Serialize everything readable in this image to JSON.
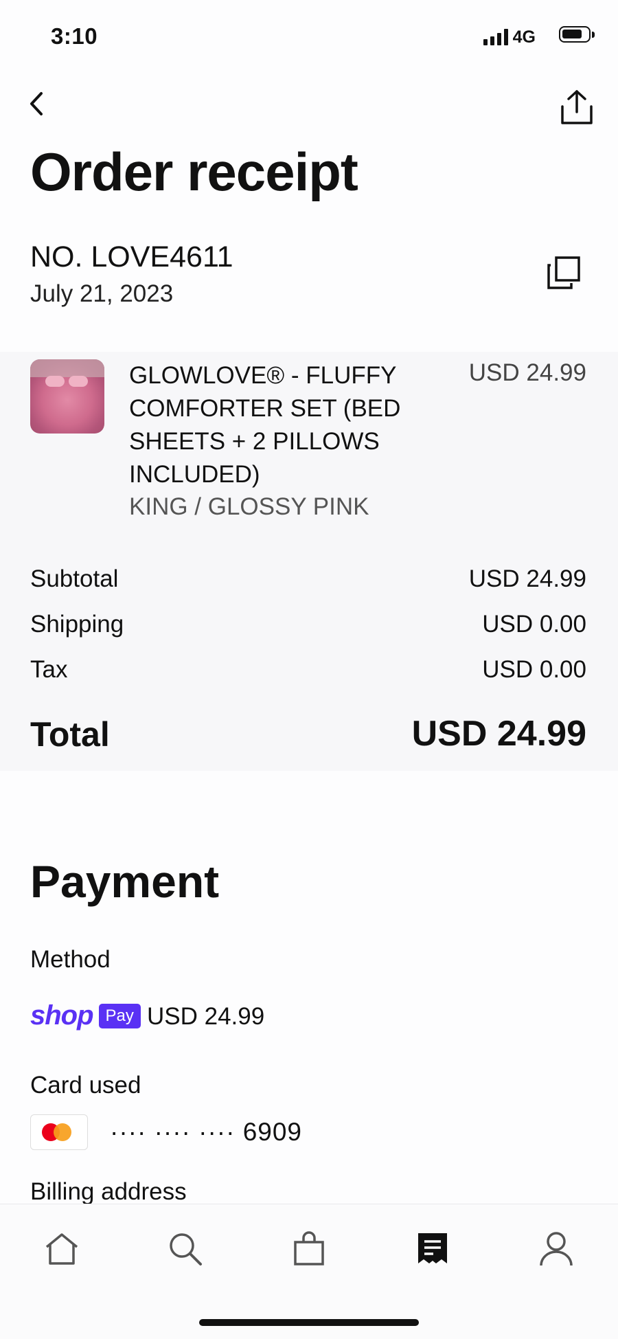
{
  "status_bar": {
    "time": "3:10",
    "network": "4G"
  },
  "header": {
    "title": "Order receipt"
  },
  "order": {
    "number": "NO. LOVE4611",
    "date": "July 21, 2023"
  },
  "item": {
    "name": "GLOWLOVE® - FLUFFY COMFORTER SET (BED SHEETS + 2 PILLOWS INCLUDED)",
    "variant": "KING / GLOSSY PINK",
    "price": "USD 24.99"
  },
  "summary": {
    "subtotal_label": "Subtotal",
    "subtotal_value": "USD 24.99",
    "shipping_label": "Shipping",
    "shipping_value": "USD 0.00",
    "tax_label": "Tax",
    "tax_value": "USD 0.00",
    "total_label": "Total",
    "total_value": "USD 24.99"
  },
  "payment": {
    "title": "Payment",
    "method_label": "Method",
    "method_brand": "shop",
    "method_brand_badge": "Pay",
    "method_amount": "USD 24.99",
    "card_label": "Card used",
    "card_digits": "···· ···· ···· 6909",
    "billing_label": "Billing address"
  },
  "icons": {
    "back": "chevron-left-icon",
    "share": "share-icon",
    "copy": "copy-icon",
    "tabs": [
      "home-icon",
      "search-icon",
      "shopping-bag-icon",
      "receipt-icon",
      "profile-icon"
    ]
  },
  "colors": {
    "shop_pay": "#5a31f4",
    "mastercard_red": "#eb001b",
    "mastercard_orange": "#f79e1b"
  }
}
